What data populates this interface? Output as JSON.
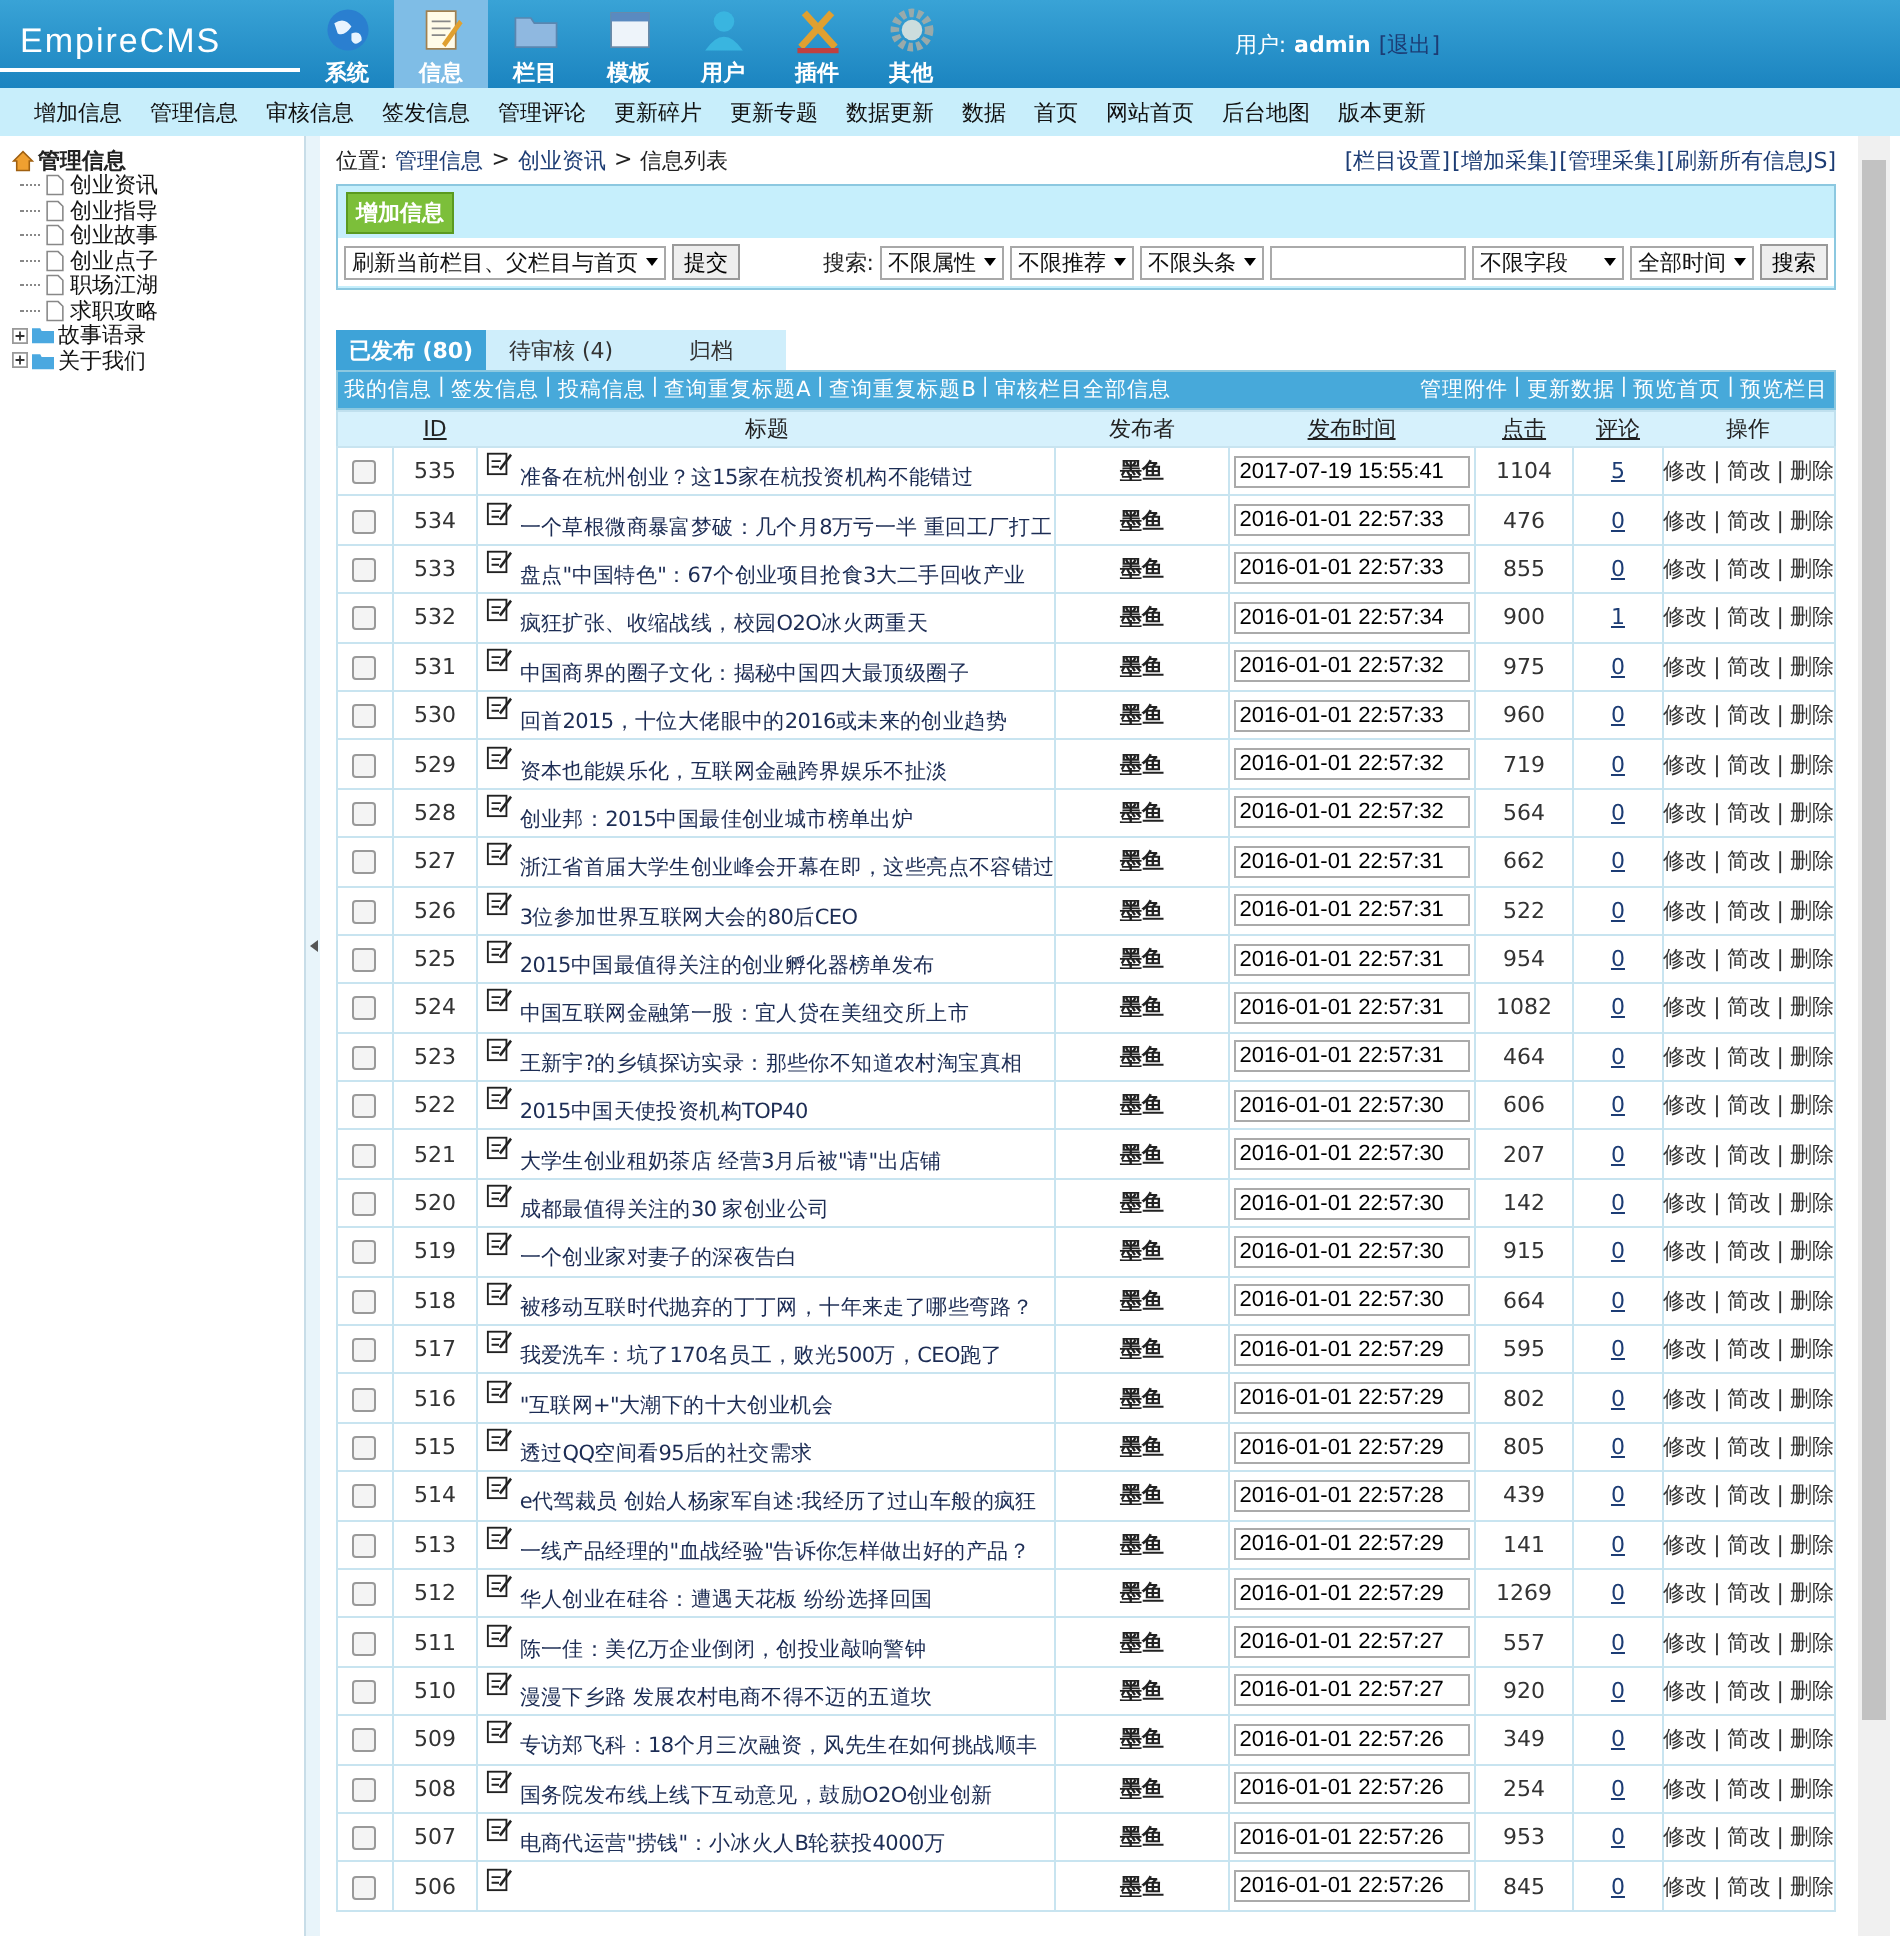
{
  "header": {
    "logo": "EmpireCMS",
    "nav": [
      {
        "kind": "globe",
        "label": "系统",
        "selected": false
      },
      {
        "kind": "note",
        "label": "信息",
        "selected": true
      },
      {
        "kind": "folder",
        "label": "栏目",
        "selected": false
      },
      {
        "kind": "window",
        "label": "模板",
        "selected": false
      },
      {
        "kind": "user",
        "label": "用户",
        "selected": false
      },
      {
        "kind": "tools",
        "label": "插件",
        "selected": false
      },
      {
        "kind": "gear",
        "label": "其他",
        "selected": false
      }
    ],
    "user_label": "用户:",
    "user_name": "admin",
    "logout": "[退出]"
  },
  "menu": [
    "增加信息",
    "管理信息",
    "审核信息",
    "签发信息",
    "管理评论",
    "更新碎片",
    "更新专题",
    "数据更新",
    "数据",
    "首页",
    "网站首页",
    "后台地图",
    "版本更新"
  ],
  "sidebar": {
    "root": "管理信息",
    "items": [
      {
        "kind": "page",
        "label": "创业资讯"
      },
      {
        "kind": "page",
        "label": "创业指导"
      },
      {
        "kind": "page",
        "label": "创业故事"
      },
      {
        "kind": "page",
        "label": "创业点子"
      },
      {
        "kind": "page",
        "label": "职场江湖"
      },
      {
        "kind": "page",
        "label": "求职攻略"
      },
      {
        "kind": "folder",
        "label": "故事语录",
        "expanded": false
      },
      {
        "kind": "folder",
        "label": "关于我们",
        "expanded": false
      }
    ]
  },
  "breadcrumb": {
    "label": "位置:",
    "parts": [
      "管理信息",
      "创业资讯",
      "信息列表"
    ],
    "separator": ">"
  },
  "top_links": [
    "[栏目设置]",
    "[增加采集]",
    "[管理采集]",
    "[刷新所有信息JS]"
  ],
  "toolbar": {
    "add_button": "增加信息",
    "refresh_select": "刷新当前栏目、父栏目与首页",
    "submit": "提交",
    "search_label": "搜索:",
    "filters": [
      "不限属性",
      "不限推荐",
      "不限头条"
    ],
    "field_select": "不限字段",
    "time_select": "全部时间",
    "search_button": "搜索"
  },
  "tabs": [
    {
      "label": "已发布 (80)",
      "selected": true
    },
    {
      "label": "待审核 (4)",
      "selected": false
    },
    {
      "label": "归档",
      "selected": false
    }
  ],
  "subnav_separator": "|",
  "subnav_left": [
    "我的信息",
    "签发信息",
    "投稿信息",
    "查询重复标题A",
    "查询重复标题B",
    "审核栏目全部信息"
  ],
  "subnav_right": [
    "管理附件",
    "更新数据",
    "预览首页",
    "预览栏目"
  ],
  "table": {
    "columns": [
      "ID",
      "标题",
      "发布者",
      "发布时间",
      "点击",
      "评论",
      "操作"
    ],
    "action_separator": "|",
    "rows": [
      {
        "checked": false,
        "id": "535",
        "title": "准备在杭州创业？这15家在杭投资机构不能错过",
        "publisher": "墨鱼",
        "time": "2017-07-19 15:55:41",
        "clicks": "1104",
        "comments": "5",
        "actions": [
          "修改",
          "简改",
          "删除"
        ]
      },
      {
        "checked": false,
        "id": "534",
        "title": "一个草根微商暴富梦破：几个月8万亏一半 重回工厂打工",
        "publisher": "墨鱼",
        "time": "2016-01-01 22:57:33",
        "clicks": "476",
        "comments": "0",
        "actions": [
          "修改",
          "简改",
          "删除"
        ]
      },
      {
        "checked": false,
        "id": "533",
        "title": "盘点\"中国特色\"：67个创业项目抢食3大二手回收产业",
        "publisher": "墨鱼",
        "time": "2016-01-01 22:57:33",
        "clicks": "855",
        "comments": "0",
        "actions": [
          "修改",
          "简改",
          "删除"
        ]
      },
      {
        "checked": false,
        "id": "532",
        "title": "疯狂扩张、收缩战线，校园O2O冰火两重天",
        "publisher": "墨鱼",
        "time": "2016-01-01 22:57:34",
        "clicks": "900",
        "comments": "1",
        "actions": [
          "修改",
          "简改",
          "删除"
        ]
      },
      {
        "checked": false,
        "id": "531",
        "title": "中国商界的圈子文化：揭秘中国四大最顶级圈子",
        "publisher": "墨鱼",
        "time": "2016-01-01 22:57:32",
        "clicks": "975",
        "comments": "0",
        "actions": [
          "修改",
          "简改",
          "删除"
        ]
      },
      {
        "checked": false,
        "id": "530",
        "title": "回首2015，十位大佬眼中的2016或未来的创业趋势",
        "publisher": "墨鱼",
        "time": "2016-01-01 22:57:33",
        "clicks": "960",
        "comments": "0",
        "actions": [
          "修改",
          "简改",
          "删除"
        ]
      },
      {
        "checked": false,
        "id": "529",
        "title": "资本也能娱乐化，互联网金融跨界娱乐不扯淡",
        "publisher": "墨鱼",
        "time": "2016-01-01 22:57:32",
        "clicks": "719",
        "comments": "0",
        "actions": [
          "修改",
          "简改",
          "删除"
        ]
      },
      {
        "checked": false,
        "id": "528",
        "title": "创业邦：2015中国最佳创业城市榜单出炉",
        "publisher": "墨鱼",
        "time": "2016-01-01 22:57:32",
        "clicks": "564",
        "comments": "0",
        "actions": [
          "修改",
          "简改",
          "删除"
        ]
      },
      {
        "checked": false,
        "id": "527",
        "title": "浙江省首届大学生创业峰会开幕在即，这些亮点不容错过",
        "publisher": "墨鱼",
        "time": "2016-01-01 22:57:31",
        "clicks": "662",
        "comments": "0",
        "actions": [
          "修改",
          "简改",
          "删除"
        ]
      },
      {
        "checked": false,
        "id": "526",
        "title": "3位参加世界互联网大会的80后CEO",
        "publisher": "墨鱼",
        "time": "2016-01-01 22:57:31",
        "clicks": "522",
        "comments": "0",
        "actions": [
          "修改",
          "简改",
          "删除"
        ]
      },
      {
        "checked": false,
        "id": "525",
        "title": "2015中国最值得关注的创业孵化器榜单发布",
        "publisher": "墨鱼",
        "time": "2016-01-01 22:57:31",
        "clicks": "954",
        "comments": "0",
        "actions": [
          "修改",
          "简改",
          "删除"
        ]
      },
      {
        "checked": false,
        "id": "524",
        "title": "中国互联网金融第一股：宜人贷在美纽交所上市",
        "publisher": "墨鱼",
        "time": "2016-01-01 22:57:31",
        "clicks": "1082",
        "comments": "0",
        "actions": [
          "修改",
          "简改",
          "删除"
        ]
      },
      {
        "checked": false,
        "id": "523",
        "title": "王新宇?的乡镇探访实录：那些你不知道农村淘宝真相",
        "publisher": "墨鱼",
        "time": "2016-01-01 22:57:31",
        "clicks": "464",
        "comments": "0",
        "actions": [
          "修改",
          "简改",
          "删除"
        ]
      },
      {
        "checked": false,
        "id": "522",
        "title": "2015中国天使投资机构TOP40",
        "publisher": "墨鱼",
        "time": "2016-01-01 22:57:30",
        "clicks": "606",
        "comments": "0",
        "actions": [
          "修改",
          "简改",
          "删除"
        ]
      },
      {
        "checked": false,
        "id": "521",
        "title": "大学生创业租奶茶店 经营3月后被\"请\"出店铺",
        "publisher": "墨鱼",
        "time": "2016-01-01 22:57:30",
        "clicks": "207",
        "comments": "0",
        "actions": [
          "修改",
          "简改",
          "删除"
        ]
      },
      {
        "checked": false,
        "id": "520",
        "title": "成都最值得关注的30 家创业公司",
        "publisher": "墨鱼",
        "time": "2016-01-01 22:57:30",
        "clicks": "142",
        "comments": "0",
        "actions": [
          "修改",
          "简改",
          "删除"
        ]
      },
      {
        "checked": false,
        "id": "519",
        "title": "一个创业家对妻子的深夜告白",
        "publisher": "墨鱼",
        "time": "2016-01-01 22:57:30",
        "clicks": "915",
        "comments": "0",
        "actions": [
          "修改",
          "简改",
          "删除"
        ]
      },
      {
        "checked": false,
        "id": "518",
        "title": "被移动互联时代抛弃的丁丁网，十年来走了哪些弯路？",
        "publisher": "墨鱼",
        "time": "2016-01-01 22:57:30",
        "clicks": "664",
        "comments": "0",
        "actions": [
          "修改",
          "简改",
          "删除"
        ]
      },
      {
        "checked": false,
        "id": "517",
        "title": "我爱洗车：坑了170名员工，败光500万，CEO跑了",
        "publisher": "墨鱼",
        "time": "2016-01-01 22:57:29",
        "clicks": "595",
        "comments": "0",
        "actions": [
          "修改",
          "简改",
          "删除"
        ]
      },
      {
        "checked": false,
        "id": "516",
        "title": "\"互联网+\"大潮下的十大创业机会",
        "publisher": "墨鱼",
        "time": "2016-01-01 22:57:29",
        "clicks": "802",
        "comments": "0",
        "actions": [
          "修改",
          "简改",
          "删除"
        ]
      },
      {
        "checked": false,
        "id": "515",
        "title": "透过QQ空间看95后的社交需求",
        "publisher": "墨鱼",
        "time": "2016-01-01 22:57:29",
        "clicks": "805",
        "comments": "0",
        "actions": [
          "修改",
          "简改",
          "删除"
        ]
      },
      {
        "checked": false,
        "id": "514",
        "title": "e代驾裁员 创始人杨家军自述:我经历了过山车般的疯狂",
        "publisher": "墨鱼",
        "time": "2016-01-01 22:57:28",
        "clicks": "439",
        "comments": "0",
        "actions": [
          "修改",
          "简改",
          "删除"
        ]
      },
      {
        "checked": false,
        "id": "513",
        "title": "一线产品经理的\"血战经验\"告诉你怎样做出好的产品？",
        "publisher": "墨鱼",
        "time": "2016-01-01 22:57:29",
        "clicks": "141",
        "comments": "0",
        "actions": [
          "修改",
          "简改",
          "删除"
        ]
      },
      {
        "checked": false,
        "id": "512",
        "title": "华人创业在硅谷：遭遇天花板 纷纷选择回国",
        "publisher": "墨鱼",
        "time": "2016-01-01 22:57:29",
        "clicks": "1269",
        "comments": "0",
        "actions": [
          "修改",
          "简改",
          "删除"
        ]
      },
      {
        "checked": false,
        "id": "511",
        "title": "陈一佳：美亿万企业倒闭，创投业敲响警钟",
        "publisher": "墨鱼",
        "time": "2016-01-01 22:57:27",
        "clicks": "557",
        "comments": "0",
        "actions": [
          "修改",
          "简改",
          "删除"
        ]
      },
      {
        "checked": false,
        "id": "510",
        "title": "漫漫下乡路 发展农村电商不得不迈的五道坎",
        "publisher": "墨鱼",
        "time": "2016-01-01 22:57:27",
        "clicks": "920",
        "comments": "0",
        "actions": [
          "修改",
          "简改",
          "删除"
        ]
      },
      {
        "checked": false,
        "id": "509",
        "title": "专访郑飞科：18个月三次融资，风先生在如何挑战顺丰",
        "publisher": "墨鱼",
        "time": "2016-01-01 22:57:26",
        "clicks": "349",
        "comments": "0",
        "actions": [
          "修改",
          "简改",
          "删除"
        ]
      },
      {
        "checked": false,
        "id": "508",
        "title": "国务院发布线上线下互动意见，鼓励O2O创业创新",
        "publisher": "墨鱼",
        "time": "2016-01-01 22:57:26",
        "clicks": "254",
        "comments": "0",
        "actions": [
          "修改",
          "简改",
          "删除"
        ]
      },
      {
        "checked": false,
        "id": "507",
        "title": "电商代运营\"捞钱\"：小冰火人B轮获投4000万",
        "publisher": "墨鱼",
        "time": "2016-01-01 22:57:26",
        "clicks": "953",
        "comments": "0",
        "actions": [
          "修改",
          "简改",
          "删除"
        ]
      },
      {
        "checked": false,
        "id": "506",
        "publisher": "墨鱼",
        "time": "2016-01-01 22:57:26",
        "clicks": "845",
        "comments": "0",
        "actions": [
          "修改",
          "简改",
          "删除"
        ]
      }
    ]
  }
}
